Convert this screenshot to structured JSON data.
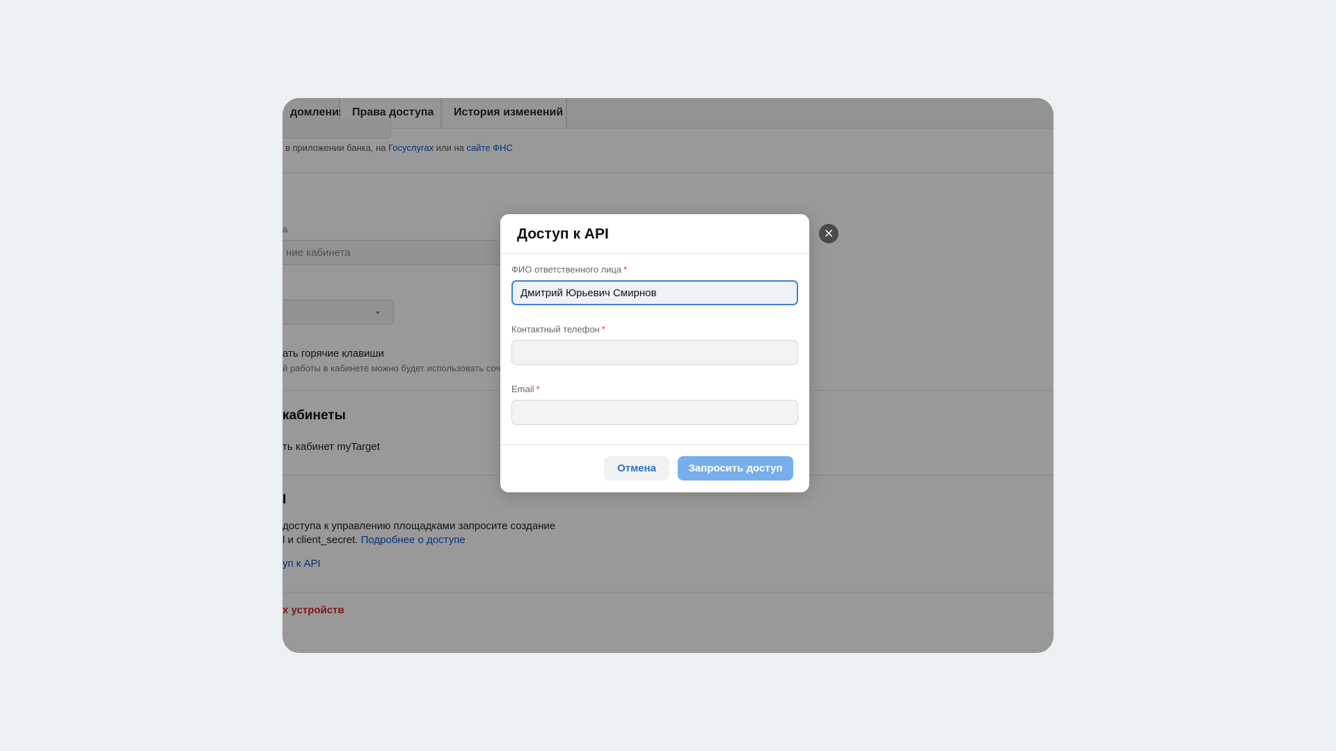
{
  "tabs": [
    {
      "label": "домления"
    },
    {
      "label": "Права доступа"
    },
    {
      "label": "История изменений"
    }
  ],
  "background": {
    "hint_text_1": "в приложении банка, на ",
    "hint_link_1": "Госуслугах",
    "hint_text_2": " или на ",
    "hint_link_2": "сайте ФНС",
    "name_field_label": "а",
    "name_field_placeholder": "ние кабинета",
    "hotkeys_label": "ать горячие клавиши",
    "hotkeys_hint": "й работы в кабинете можно будет использовать соче",
    "cabinets_heading": "кабинеты",
    "mytarget_link_text": "ть кабинет myTarget",
    "api_heading": "I",
    "api_desc_line1": "доступа к управлению площадками запросите создание",
    "api_desc_line2": "l и client_secret. ",
    "api_more_link": "Подробнее о доступе",
    "api_access_link": "уп к API",
    "devices_link": "х устройств"
  },
  "modal": {
    "title": "Доступ к API",
    "fio_label": "ФИО ответственного лица",
    "fio_value": "Дмитрий Юрьевич Смирнов",
    "phone_label": "Контактный телефон",
    "phone_value": "",
    "email_label": "Email",
    "email_value": "",
    "required_mark": "*",
    "cancel_label": "Отмена",
    "submit_label": "Запросить доступ",
    "close_icon": "×"
  },
  "colors": {
    "accent": "#3d7fd8",
    "submit_disabled": "#77aeec",
    "required": "#e0313a",
    "link": "#005bd1",
    "danger": "#d8252f"
  }
}
